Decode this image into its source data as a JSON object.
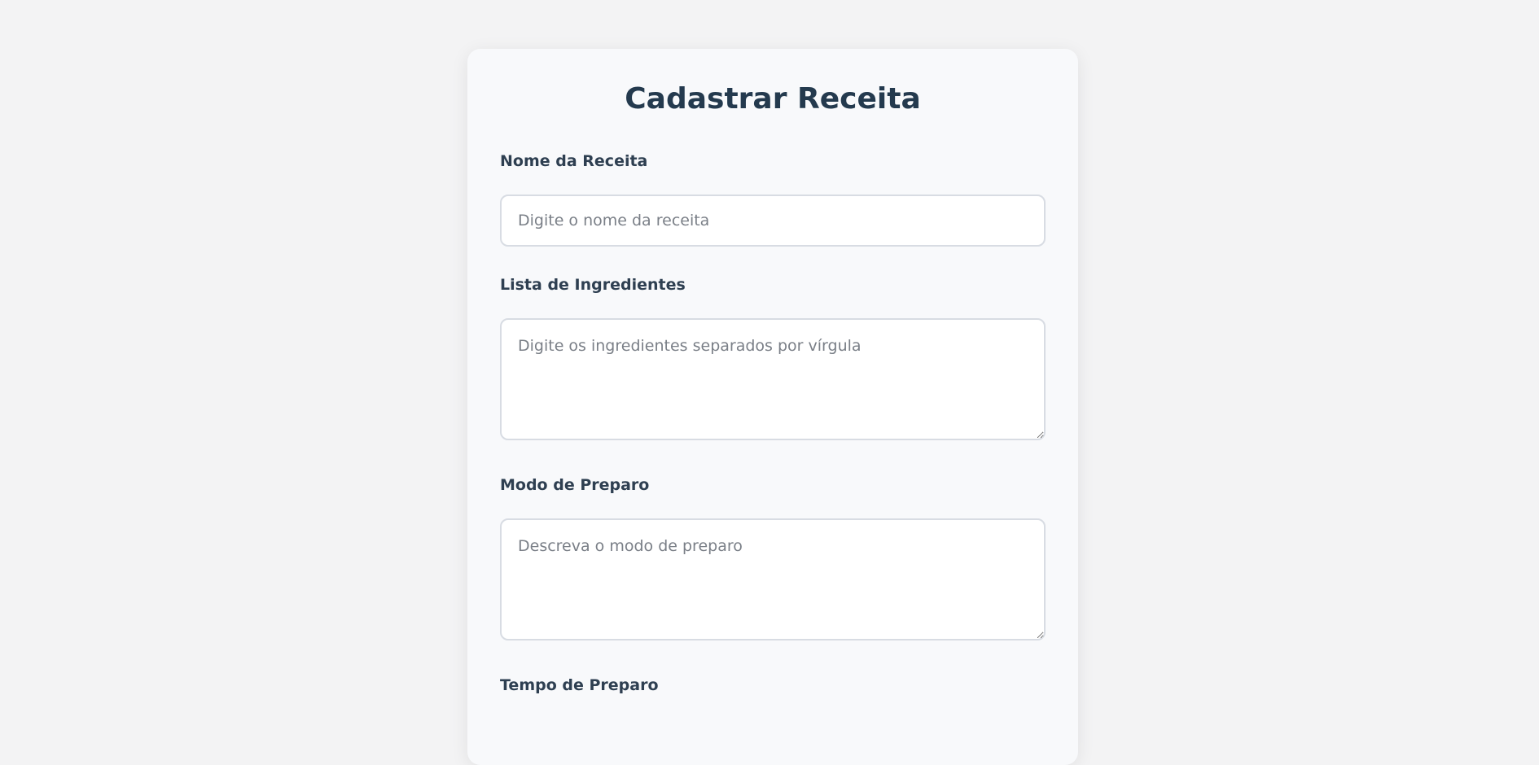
{
  "form": {
    "title": "Cadastrar Receita",
    "name": {
      "label": "Nome da Receita",
      "placeholder": "Digite o nome da receita",
      "value": ""
    },
    "ingredients": {
      "label": "Lista de Ingredientes",
      "placeholder": "Digite os ingredientes separados por vírgula",
      "value": ""
    },
    "method": {
      "label": "Modo de Preparo",
      "placeholder": "Descreva o modo de preparo",
      "value": ""
    },
    "time": {
      "label": "Tempo de Preparo"
    }
  }
}
